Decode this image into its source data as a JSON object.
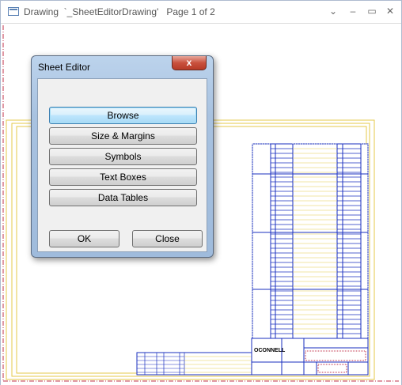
{
  "window": {
    "title": "Drawing  `_SheetEditorDrawing'   Page 1 of 2",
    "controls": {
      "menu": "⌄",
      "minimize": "–",
      "maximize": "▭",
      "close": "✕"
    }
  },
  "dialog": {
    "title": "Sheet Editor",
    "close_glyph": "x",
    "buttons": [
      "Browse",
      "Size & Margins",
      "Symbols",
      "Text Boxes",
      "Data Tables"
    ],
    "ok_label": "OK",
    "close_label": "Close"
  },
  "title_block": {
    "logo_text": "OCONNELL"
  },
  "colors": {
    "sheet_border": "#e5c94a",
    "grid_lines": "#1a2fbf",
    "page_margin": "#c0304a",
    "dialog_frame": "#a8c2e0",
    "focus_button": "#3c7fb1"
  }
}
